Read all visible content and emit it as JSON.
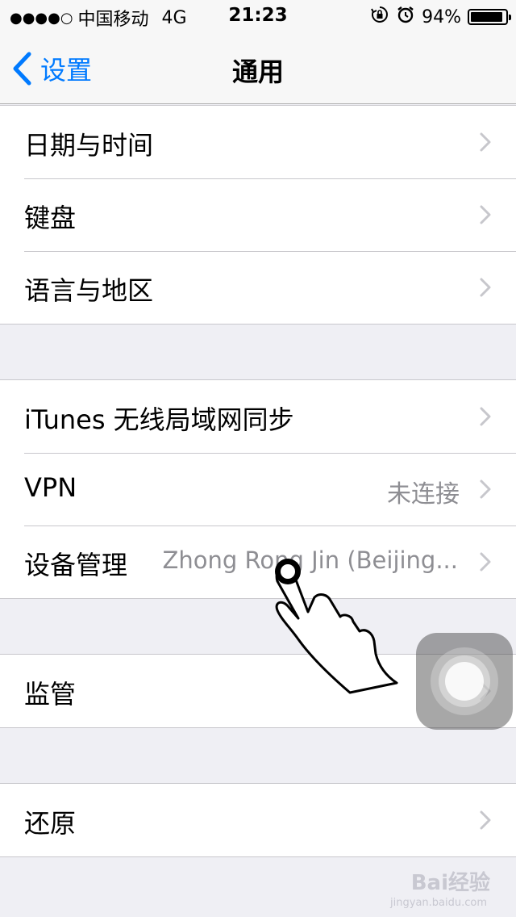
{
  "status": {
    "signal_dots": "●●●●○",
    "carrier": "中国移动",
    "network": "4G",
    "time": "21:23",
    "battery_text": "94%",
    "battery_level": 0.94
  },
  "nav": {
    "back_label": "设置",
    "title": "通用"
  },
  "groups": [
    {
      "rows": [
        {
          "label": "日期与时间",
          "value": ""
        },
        {
          "label": "键盘",
          "value": ""
        },
        {
          "label": "语言与地区",
          "value": ""
        }
      ]
    },
    {
      "rows": [
        {
          "label": "iTunes 无线局域网同步",
          "value": ""
        },
        {
          "label": "VPN",
          "value": "未连接"
        },
        {
          "label": "设备管理",
          "value": "Zhong Rong Jin (Beijing..."
        }
      ]
    },
    {
      "rows": [
        {
          "label": "监管",
          "value": ""
        }
      ]
    },
    {
      "rows": [
        {
          "label": "还原",
          "value": ""
        }
      ]
    }
  ],
  "watermark": {
    "text": "Bai经验",
    "sub": "jingyan.baidu.com"
  },
  "icons": [
    "lock-rotation-icon",
    "alarm-icon",
    "battery-icon",
    "back-chevron-icon",
    "chevron-right-icon",
    "hand-pointer-icon",
    "assistive-touch-icon"
  ]
}
